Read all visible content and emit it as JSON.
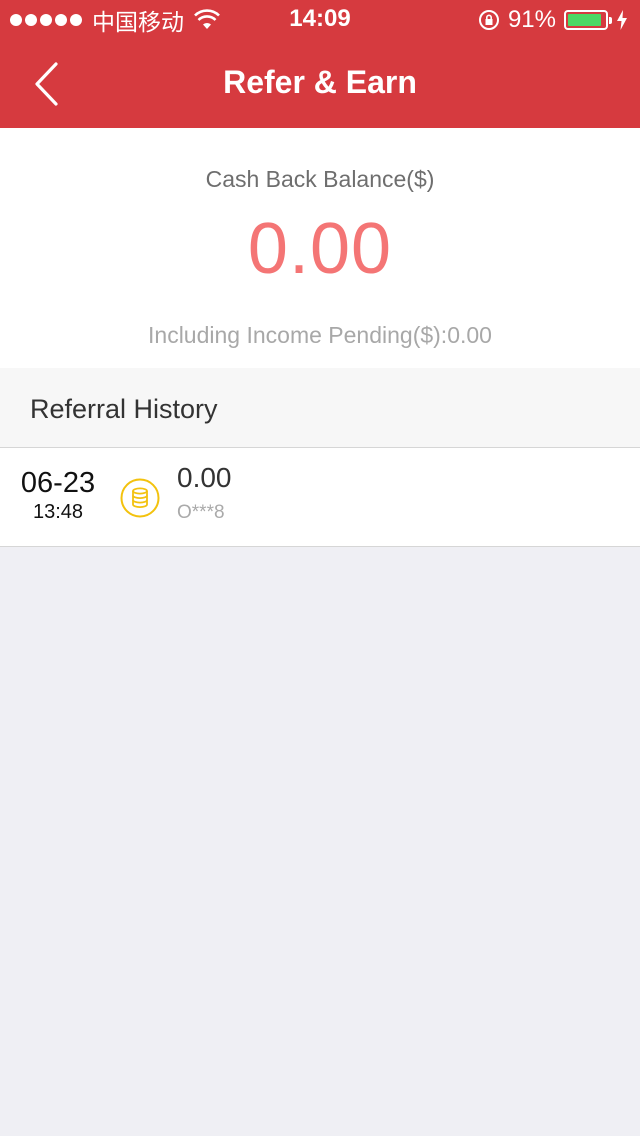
{
  "status_bar": {
    "carrier": "中国移动",
    "time": "14:09",
    "battery_percent": "91%",
    "battery_level": 0.91,
    "battery_color": "#4cd964",
    "icons": [
      "signal-dots-icon",
      "wifi-icon",
      "rotation-lock-icon",
      "battery-icon",
      "charging-bolt-icon"
    ]
  },
  "navbar": {
    "title": "Refer & Earn",
    "back_icon": "chevron-left-icon",
    "background": "#d63a3f"
  },
  "balance": {
    "label": "Cash Back Balance($)",
    "amount": "0.00",
    "pending": "Including Income Pending($):0.00",
    "amount_color": "#f47575"
  },
  "history": {
    "title": "Referral History",
    "items": [
      {
        "date": "06-23",
        "time": "13:48",
        "icon": "coin-stack-icon",
        "amount": "0.00",
        "user": "O***8"
      }
    ]
  }
}
